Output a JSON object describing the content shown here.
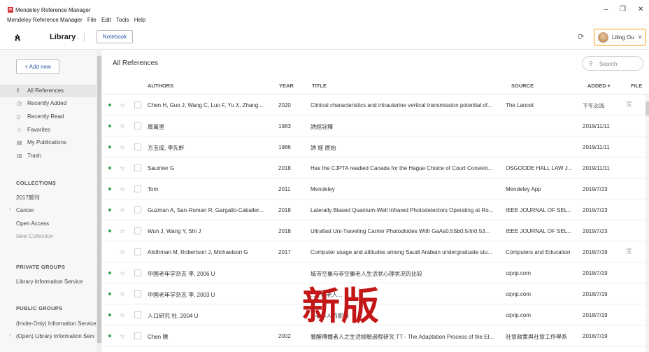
{
  "window": {
    "title": "Mendeley Reference Manager",
    "menu": [
      "Mendeley Reference Manager",
      "File",
      "Edit",
      "Tools",
      "Help"
    ],
    "controls": [
      "–",
      "❐",
      "✕"
    ]
  },
  "header": {
    "logo_glyph": "ጰ",
    "library_label": "Library",
    "notebook_label": "Notebook",
    "user_name": "Liling Ou"
  },
  "sidebar": {
    "add_new": "+ Add new",
    "nav": [
      {
        "label": "All References",
        "icon": "library-icon",
        "glyph": "⫴",
        "active": true
      },
      {
        "label": "Recently Added",
        "icon": "clock-icon",
        "glyph": "◷"
      },
      {
        "label": "Recently Read",
        "icon": "bookmark-icon",
        "glyph": "▯"
      },
      {
        "label": "Favorites",
        "icon": "star-icon",
        "glyph": "☆"
      },
      {
        "label": "My Publications",
        "icon": "publication-icon",
        "glyph": "▤"
      },
      {
        "label": "Trash",
        "icon": "trash-icon",
        "glyph": "🗑"
      }
    ],
    "collections_heading": "COLLECTIONS",
    "collections": [
      "2017館刊",
      "Cancer",
      "Open Access",
      "New Collection"
    ],
    "private_heading": "PRIVATE GROUPS",
    "private_groups": [
      "Library Information Service"
    ],
    "public_heading": "PUBLIC GROUPS",
    "public_groups": [
      "(Invite-Only) Information Service",
      "(Open) Library Information Serv"
    ]
  },
  "main": {
    "title": "All References",
    "search_placeholder": "Search",
    "columns": {
      "authors": "AUTHORS",
      "year": "YEAR",
      "title": "TITLE",
      "source": "SOURCE",
      "added": "ADDED",
      "file": "FILE"
    },
    "rows": [
      {
        "dot": true,
        "authors": "Chen H, Guo J, Wang C, Luo F, Yu X, Zhang ...",
        "year": "2020",
        "title": "Clinical characteristics and intrauterine vertical transmission potential of...",
        "source": "The Lancet",
        "added": "下午3:05",
        "file": true
      },
      {
        "dot": true,
        "authors": "周萬里",
        "year": "1983",
        "title": "詩經詮釋",
        "source": "",
        "added": "2019/11/11",
        "file": false
      },
      {
        "dot": true,
        "authors": "方玉成, 李先軒",
        "year": "1986",
        "title": "詩 經 原始",
        "source": "",
        "added": "2019/11/11",
        "file": false
      },
      {
        "dot": true,
        "authors": "Saumier G",
        "year": "2018",
        "title": "Has the CJPTA readied Canada for the Hague Choice of Court Convent...",
        "source": "OSGOODE HALL LAW J...",
        "added": "2019/11/11",
        "file": false
      },
      {
        "dot": true,
        "authors": "Tom",
        "year": "2011",
        "title": "Mendeley",
        "source": "Mendeley App",
        "added": "2019/7/23",
        "file": false
      },
      {
        "dot": true,
        "authors": "Guzman A, San-Roman R, Gargallo-Caballer...",
        "year": "2018",
        "title": "Laterally Biased Quantum-Well Infrared Photodetectors Operating at Ro...",
        "source": "IEEE JOURNAL OF SEL...",
        "added": "2019/7/23",
        "file": false
      },
      {
        "dot": true,
        "authors": "Wun J, Wang Y, Shi J",
        "year": "2018",
        "title": "Ultrafast Uni-Traveling Carrier Photodiodes With GaAs0.5Sb0.5/In0.53...",
        "source": "IEEE JOURNAL OF SEL...",
        "added": "2019/7/23",
        "file": false
      },
      {
        "dot": false,
        "authors": "Alothman M, Robertson J, Michaelson G",
        "year": "2017",
        "title": "Computer usage and attitudes among Saudi Arabian undergraduate stu...",
        "source": "Computers and Education",
        "added": "2018/7/19",
        "file": true
      },
      {
        "dot": true,
        "authors": "中国老年学杂志 李, 2006 U",
        "year": "",
        "title": "城市空巢与非空巢老人生活状心理状况的比较",
        "source": "cqvip.com",
        "added": "2018/7/19",
        "file": false
      },
      {
        "dot": true,
        "authors": "中国老年学杂志 李, 2003 U",
        "year": "",
        "title": "...空巢老人...",
        "source": "cqvip.com",
        "added": "2018/7/19",
        "file": false
      },
      {
        "dot": true,
        "authors": "人口研究 杜, 2004 U",
        "year": "",
        "title": "...老年人的影响",
        "source": "cqvip.com",
        "added": "2018/7/19",
        "file": false
      },
      {
        "dot": true,
        "authors": "Chen 陳",
        "year": "2002",
        "title": "覺醒傳播者人之生活經驗過程研究 TT - The Adaptation Process of the El...",
        "source": "社會政策與社會工作學系",
        "added": "2018/7/19",
        "file": false
      }
    ]
  },
  "overlay": {
    "watermark": "新版"
  },
  "colors": {
    "accent": "#2c5aa0",
    "dot": "#2ca24a",
    "watermark": "#c31616",
    "user_border": "#f0a000"
  }
}
